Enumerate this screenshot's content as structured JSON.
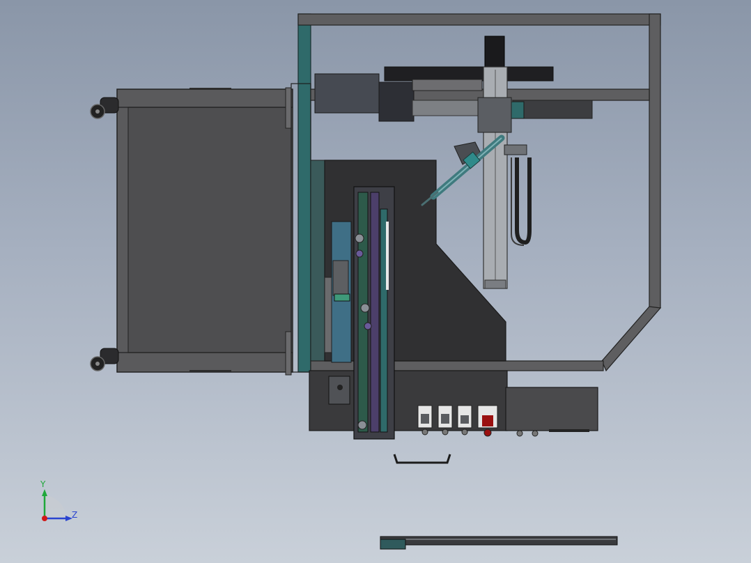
{
  "viewport": {
    "background_top": "#8a96a8",
    "background_bottom": "#c9d0d9"
  },
  "triad": {
    "y_label": "Y",
    "z_label": "Z",
    "y_color": "#1fa83a",
    "z_color": "#2a44d0",
    "x_color": "#d01818"
  },
  "palette": {
    "frame_dark": "#3c3c3e",
    "frame_light": "#5e5e60",
    "panel_fill": "#4b4b4d",
    "teal": "#2f6a6a",
    "cabinet": "#303032",
    "button_red": "#9a1010",
    "button_white": "#e6e6e6"
  },
  "model": {
    "components": [
      "mobile-cart-frame",
      "caster-wheel",
      "safety-guard-frame",
      "linear-gantry-axis",
      "dispensing-nozzle",
      "rotary-index-table",
      "control-cabinet",
      "control-panel-buttons",
      "cabinet-handle",
      "floor-rail"
    ]
  }
}
